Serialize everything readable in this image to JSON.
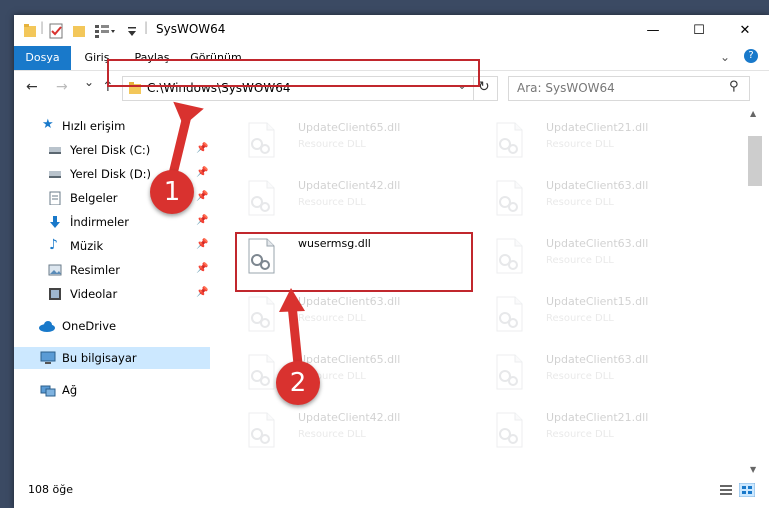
{
  "window": {
    "title": "SysWOW64",
    "controls": {
      "minimize": "—",
      "maximize": "☐",
      "close": "✕"
    }
  },
  "ribbon": {
    "tabs": [
      "Dosya",
      "Giriş",
      "Paylaş",
      "Görünüm"
    ],
    "help": "?"
  },
  "nav": {
    "back": "←",
    "forward": "→",
    "history": "⌄",
    "up": "↑",
    "address": "C:\\Windows\\SysWOW64",
    "address_dropdown": "⌄",
    "refresh": "↻",
    "search_placeholder": "Ara: SysWOW64",
    "search_icon": "⚲"
  },
  "sidebar": {
    "quick_access": "Hızlı erişim",
    "items": [
      {
        "label": "Yerel Disk (C:)",
        "icon": "drive-icon",
        "pinned": true
      },
      {
        "label": "Yerel Disk (D:)",
        "icon": "drive-icon",
        "pinned": true
      },
      {
        "label": "Belgeler",
        "icon": "documents-icon",
        "pinned": true
      },
      {
        "label": "İndirmeler",
        "icon": "downloads-icon",
        "pinned": true
      },
      {
        "label": "Müzik",
        "icon": "music-icon",
        "pinned": true
      },
      {
        "label": "Resimler",
        "icon": "pictures-icon",
        "pinned": true
      },
      {
        "label": "Videolar",
        "icon": "videos-icon",
        "pinned": true
      }
    ],
    "onedrive": "OneDrive",
    "this_pc": "Bu bilgisayar",
    "network": "Ağ"
  },
  "files": {
    "left": [
      {
        "name": "UpdateClient65.dll",
        "desc": "Resource DLL"
      },
      {
        "name": "UpdateClient42.dll",
        "desc": "Resource DLL"
      },
      {
        "name": "wusermsg.dll",
        "desc": ""
      },
      {
        "name": "UpdateClient63.dll",
        "desc": "Resource DLL"
      },
      {
        "name": "UpdateClient65.dll",
        "desc": "Resource DLL"
      },
      {
        "name": "UpdateClient42.dll",
        "desc": "Resource DLL"
      }
    ],
    "right": [
      {
        "name": "UpdateClient21.dll",
        "desc": "Resource DLL"
      },
      {
        "name": "UpdateClient63.dll",
        "desc": "Resource DLL"
      },
      {
        "name": "UpdateClient63.dll",
        "desc": "Resource DLL"
      },
      {
        "name": "UpdateClient15.dll",
        "desc": "Resource DLL"
      },
      {
        "name": "UpdateClient63.dll",
        "desc": "Resource DLL"
      },
      {
        "name": "UpdateClient21.dll",
        "desc": "Resource DLL"
      }
    ]
  },
  "annotations": {
    "badge1": "1",
    "badge2": "2",
    "highlight_color": "#c1272d",
    "badge_color": "#d9322f"
  },
  "status": {
    "count": "108 öğe"
  },
  "colors": {
    "accent": "#1979ca",
    "selected_bg": "#cce8ff"
  }
}
